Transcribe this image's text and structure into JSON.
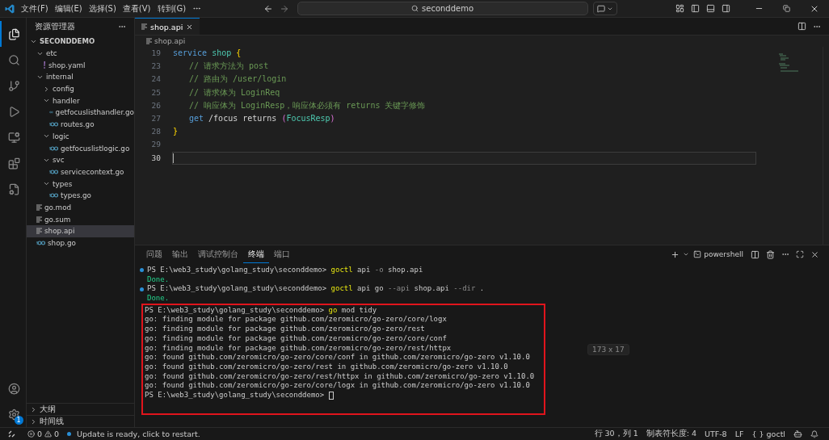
{
  "menu": [
    "文件(F)",
    "编辑(E)",
    "选择(S)",
    "查看(V)",
    "转到(G)"
  ],
  "search": {
    "value": "seconddemo"
  },
  "explorer": {
    "title": "资源管理器",
    "root": "SECONDDEMO",
    "tree": [
      {
        "name": "etc",
        "kind": "folder",
        "expanded": true,
        "selected": false,
        "children": [
          {
            "name": "shop.yaml",
            "kind": "yaml",
            "selected": false
          }
        ]
      },
      {
        "name": "internal",
        "kind": "folder",
        "expanded": true,
        "selected": false,
        "children": [
          {
            "name": "config",
            "kind": "folder",
            "expanded": false,
            "selected": false
          },
          {
            "name": "handler",
            "kind": "folder",
            "expanded": true,
            "selected": false,
            "children": [
              {
                "name": "getfocuslisthandler.go",
                "kind": "go",
                "selected": false
              },
              {
                "name": "routes.go",
                "kind": "go",
                "selected": false
              }
            ]
          },
          {
            "name": "logic",
            "kind": "folder",
            "expanded": true,
            "selected": false,
            "children": [
              {
                "name": "getfocuslistlogic.go",
                "kind": "go",
                "selected": false
              }
            ]
          },
          {
            "name": "svc",
            "kind": "folder",
            "expanded": true,
            "selected": false,
            "children": [
              {
                "name": "servicecontext.go",
                "kind": "go",
                "selected": false
              }
            ]
          },
          {
            "name": "types",
            "kind": "folder",
            "expanded": true,
            "selected": false,
            "children": [
              {
                "name": "types.go",
                "kind": "go",
                "selected": false
              }
            ]
          }
        ]
      },
      {
        "name": "go.mod",
        "kind": "text",
        "selected": false
      },
      {
        "name": "go.sum",
        "kind": "text",
        "selected": false
      },
      {
        "name": "shop.api",
        "kind": "text",
        "selected": true
      },
      {
        "name": "shop.go",
        "kind": "go",
        "selected": false
      }
    ],
    "sections": [
      {
        "title": "大纲",
        "expanded": false
      },
      {
        "title": "时间线",
        "expanded": false
      }
    ]
  },
  "tabs": [
    {
      "label": "shop.api",
      "selected": true
    }
  ],
  "breadcrumb": "shop.api",
  "code": [
    {
      "number": "19",
      "current": false,
      "tokens": [
        {
          "kind": "keyword",
          "text": "service "
        },
        {
          "kind": "type",
          "text": "shop "
        },
        {
          "kind": "brace",
          "text": "{"
        }
      ],
      "children": [
        {
          "number": "23",
          "current": false,
          "tokens": [
            {
              "kind": "comment",
              "text": "// 请求方法为 post"
            }
          ]
        },
        {
          "number": "24",
          "current": false,
          "tokens": [
            {
              "kind": "comment",
              "text": "// 路由为 /user/login"
            }
          ]
        },
        {
          "number": "25",
          "current": false,
          "tokens": [
            {
              "kind": "comment",
              "text": "// 请求体为 LoginReq"
            }
          ]
        },
        {
          "number": "26",
          "current": false,
          "tokens": [
            {
              "kind": "comment",
              "text": "// 响应体为 LoginResp，响应体必须有 returns 关键字修饰"
            }
          ]
        },
        {
          "number": "27",
          "current": false,
          "tokens": [
            {
              "kind": "keyword",
              "text": "get"
            },
            {
              "kind": "plain",
              "text": " /focus returns "
            },
            {
              "kind": "paren",
              "text": "("
            },
            {
              "kind": "type",
              "text": "FocusResp"
            },
            {
              "kind": "paren",
              "text": ")"
            }
          ]
        }
      ]
    },
    {
      "number": "28",
      "current": false,
      "tokens": [
        {
          "kind": "brace",
          "text": "}"
        }
      ]
    },
    {
      "number": "29",
      "current": false
    },
    {
      "number": "30",
      "current": true
    }
  ],
  "panel": {
    "tabs": [
      {
        "label": "问题",
        "selected": false
      },
      {
        "label": "输出",
        "selected": false
      },
      {
        "label": "调试控制台",
        "selected": false
      },
      {
        "label": "终端",
        "selected": true
      },
      {
        "label": "端口",
        "selected": false
      }
    ],
    "shell": "powershell",
    "terminal": [
      {
        "kind": "prompt",
        "dot": true,
        "tokens": [
          {
            "kind": "plain",
            "text": "PS E:\\web3_study\\golang_study\\seconddemo> "
          },
          {
            "kind": "cmd",
            "text": "goctl"
          },
          {
            "kind": "plain",
            "text": " api "
          },
          {
            "kind": "flag",
            "text": "-o"
          },
          {
            "kind": "plain",
            "text": " shop.api"
          }
        ]
      },
      {
        "kind": "done",
        "dot": false,
        "tokens": [
          {
            "kind": "plain",
            "text": "Done."
          }
        ]
      },
      {
        "kind": "prompt",
        "dot": true,
        "tokens": [
          {
            "kind": "plain",
            "text": "PS E:\\web3_study\\golang_study\\seconddemo> "
          },
          {
            "kind": "cmd",
            "text": "goctl"
          },
          {
            "kind": "plain",
            "text": " api go "
          },
          {
            "kind": "flag",
            "text": "--api"
          },
          {
            "kind": "plain",
            "text": " shop.api "
          },
          {
            "kind": "flag",
            "text": "--dir"
          },
          {
            "kind": "plain",
            "text": " ."
          }
        ]
      },
      {
        "kind": "done",
        "dot": false,
        "tokens": [
          {
            "kind": "plain",
            "text": "Done."
          }
        ]
      }
    ],
    "highlight_box": [
      {
        "kind": "prompt",
        "tokens": [
          {
            "kind": "plain",
            "text": "PS E:\\web3_study\\golang_study\\seconddemo> "
          },
          {
            "kind": "cmd",
            "text": "go"
          },
          {
            "kind": "plain",
            "text": " mod tidy"
          }
        ]
      },
      {
        "kind": "output",
        "tokens": [
          {
            "kind": "plain",
            "text": "go: finding module for package github.com/zeromicro/go-zero/core/logx"
          }
        ]
      },
      {
        "kind": "output",
        "tokens": [
          {
            "kind": "plain",
            "text": "go: finding module for package github.com/zeromicro/go-zero/rest"
          }
        ]
      },
      {
        "kind": "output",
        "tokens": [
          {
            "kind": "plain",
            "text": "go: finding module for package github.com/zeromicro/go-zero/core/conf"
          }
        ]
      },
      {
        "kind": "output",
        "tokens": [
          {
            "kind": "plain",
            "text": "go: finding module for package github.com/zeromicro/go-zero/rest/httpx"
          }
        ]
      },
      {
        "kind": "output",
        "tokens": [
          {
            "kind": "plain",
            "text": "go: found github.com/zeromicro/go-zero/core/conf in github.com/zeromicro/go-zero v1.10.0"
          }
        ]
      },
      {
        "kind": "output",
        "tokens": [
          {
            "kind": "plain",
            "text": "go: found github.com/zeromicro/go-zero/rest in github.com/zeromicro/go-zero v1.10.0"
          }
        ]
      },
      {
        "kind": "output",
        "tokens": [
          {
            "kind": "plain",
            "text": "go: found github.com/zeromicro/go-zero/rest/httpx in github.com/zeromicro/go-zero v1.10.0"
          }
        ]
      },
      {
        "kind": "output",
        "tokens": [
          {
            "kind": "plain",
            "text": "go: found github.com/zeromicro/go-zero/core/logx in github.com/zeromicro/go-zero v1.10.0"
          }
        ]
      },
      {
        "kind": "cursor",
        "tokens": [
          {
            "kind": "plain",
            "text": "PS E:\\web3_study\\golang_study\\seconddemo> "
          }
        ]
      }
    ],
    "size_label": "173 x 17"
  },
  "gear_badge": "1",
  "status": {
    "errors": "0",
    "warnings": "0",
    "message": "Update is ready, click to restart.",
    "position": "行 30，列 1",
    "tab_size": "制表符长度: 4",
    "encoding": "UTF-8",
    "eol": "LF",
    "braces": "{ }",
    "language": "goctl"
  }
}
